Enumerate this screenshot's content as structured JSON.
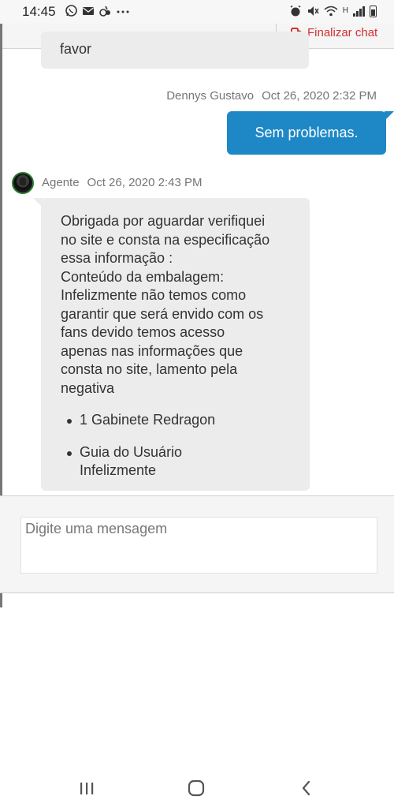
{
  "status_bar": {
    "time": "14:45",
    "notification_icons": [
      "whatsapp-icon",
      "mail-icon",
      "app-icon",
      "more-icon"
    ],
    "system_icons": [
      "alarm-icon",
      "mute-icon",
      "wifi-icon",
      "signal-icon",
      "battery-icon"
    ],
    "network_label": "H"
  },
  "header": {
    "end_chat_label": "Finalizar chat",
    "accent_color": "#d32f2f"
  },
  "messages": {
    "previous_fragment": "favor",
    "user": {
      "name": "Dennys Gustavo",
      "time": "Oct 26, 2020 2:32 PM",
      "text": "Sem problemas.",
      "bubble_color": "#1e88c6"
    },
    "agent": {
      "name": "Agente",
      "time": "Oct 26, 2020 2:43 PM",
      "lines": [
        "Obrigada por aguardar verifiquei",
        "no site e consta na especificação",
        "essa informação :",
        "Conteúdo da embalagem:",
        "Infelizmente não temos como",
        "garantir que será envido com os",
        "fans devido temos acesso",
        "apenas nas informações que",
        "consta no site, lamento pela",
        "negativa"
      ],
      "list_items": [
        {
          "line1": "1 Gabinete Redragon",
          "line2": ""
        },
        {
          "line1": "Guia do Usuário",
          "line2": "Infelizmente"
        }
      ]
    }
  },
  "composer": {
    "placeholder": "Digite uma mensagem",
    "value": ""
  },
  "nav_bar": {
    "buttons": [
      "recent-apps-icon",
      "home-icon",
      "back-icon"
    ]
  }
}
